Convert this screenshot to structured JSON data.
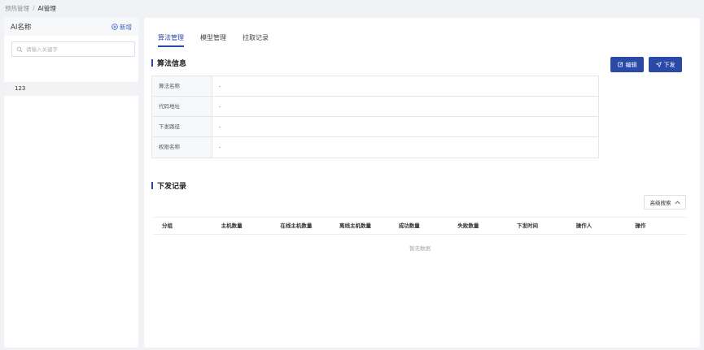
{
  "breadcrumb": {
    "parent": "预热管理",
    "separator": "/",
    "current": "AI管理"
  },
  "sidebar": {
    "title": "AI名称",
    "add_label": "新增",
    "search_placeholder": "请输入关键字",
    "items": [
      {
        "label": "123"
      }
    ]
  },
  "tabs": [
    {
      "label": "算法管理",
      "active": true
    },
    {
      "label": "模型管理",
      "active": false
    },
    {
      "label": "拉取记录",
      "active": false
    }
  ],
  "info_section": {
    "title": "算法信息",
    "edit_label": "编辑",
    "dispatch_label": "下发",
    "rows": [
      {
        "label": "算法名称",
        "value": "-"
      },
      {
        "label": "代码地址",
        "value": "-"
      },
      {
        "label": "下发路径",
        "value": "-"
      },
      {
        "label": "权限名称",
        "value": "-"
      }
    ]
  },
  "records_section": {
    "title": "下发记录",
    "advanced_search_label": "高级搜索",
    "columns": [
      "分组",
      "主机数量",
      "在线主机数量",
      "离线主机数量",
      "成功数量",
      "失败数量",
      "下发时间",
      "操作人",
      "操作"
    ],
    "empty_text": "暂无数据"
  },
  "colors": {
    "primary": "#2b4aa8",
    "background": "#f0f2f5"
  }
}
